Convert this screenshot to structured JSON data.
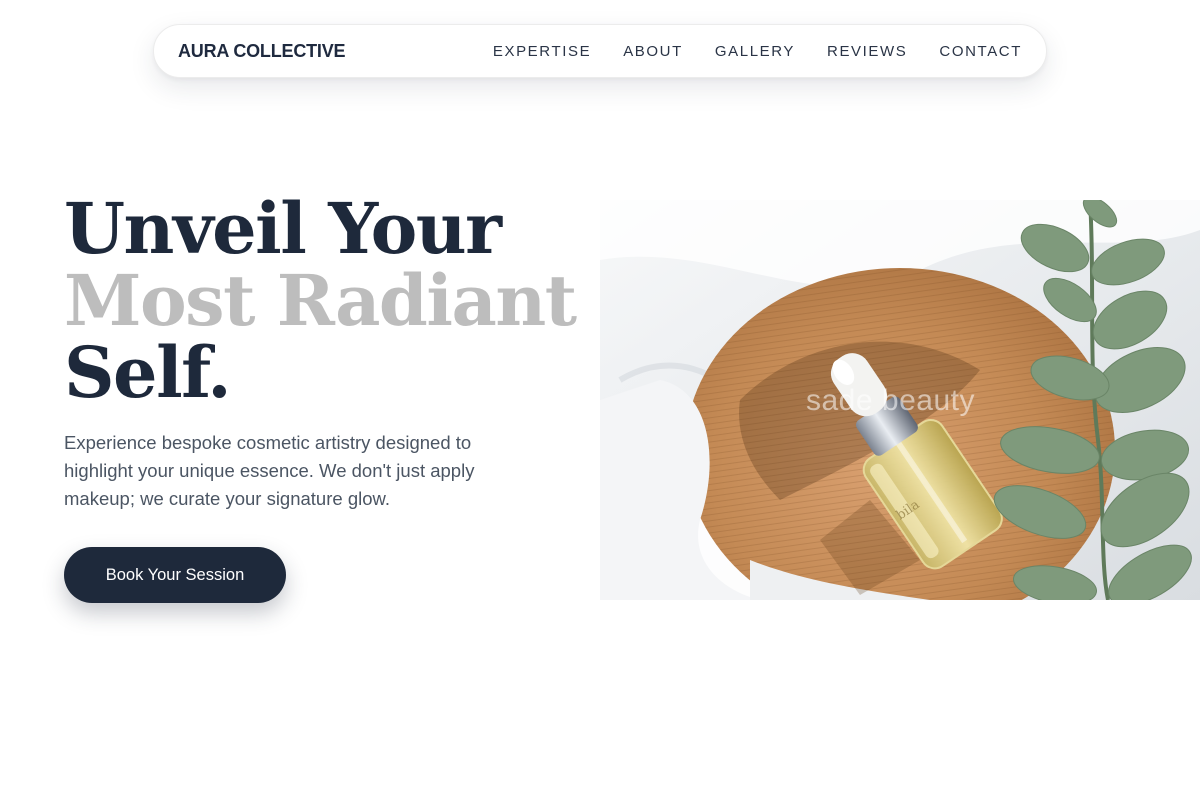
{
  "nav": {
    "brand": "AURA COLLECTIVE",
    "links": [
      "EXPERTISE",
      "ABOUT",
      "GALLERY",
      "REVIEWS",
      "CONTACT"
    ]
  },
  "hero": {
    "headline_line1": "Unveil Your",
    "headline_line2": "Most Radiant",
    "headline_line3": "Self.",
    "subtitle": "Experience bespoke cosmetic artistry designed to highlight your unique essence. We don't just apply makeup; we curate your signature glow.",
    "cta_label": "Book Your Session"
  },
  "image": {
    "watermark": "sade beauty",
    "bottle_label": "bila"
  },
  "colors": {
    "primary": "#1e293b",
    "muted_headline": "#bdbdbd",
    "body_text": "#4b5563",
    "background": "#ffffff"
  }
}
